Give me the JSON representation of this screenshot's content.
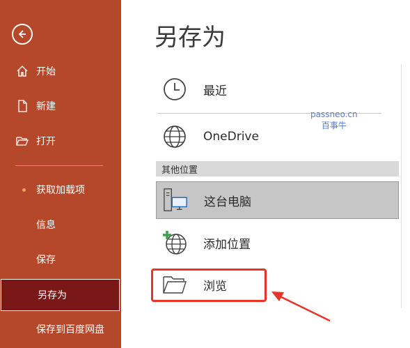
{
  "sidebar": {
    "items": [
      {
        "label": "开始",
        "icon": "home-icon"
      },
      {
        "label": "新建",
        "icon": "new-document-icon"
      },
      {
        "label": "打开",
        "icon": "open-folder-icon"
      },
      {
        "label": "获取加载项"
      },
      {
        "label": "信息"
      },
      {
        "label": "保存"
      },
      {
        "label": "另存为"
      },
      {
        "label": "保存到百度网盘"
      }
    ],
    "active_item": "另存为",
    "bg_color": "#b5472b",
    "active_color": "#7a1717"
  },
  "main": {
    "title": "另存为",
    "recent": {
      "label": "最近",
      "icon": "clock-icon"
    },
    "onedrive": {
      "label": "OneDrive",
      "icon": "globe-icon"
    },
    "other_locations_header": "其他位置",
    "this_pc": {
      "label": "这台电脑",
      "icon": "computer-icon"
    },
    "add_location": {
      "label": "添加位置",
      "icon": "add-globe-icon"
    },
    "browse": {
      "label": "浏览",
      "icon": "folder-icon"
    }
  },
  "watermark": {
    "line1": "passneo.cn",
    "line2": "百事牛"
  },
  "annotation_color": "#e8332a"
}
